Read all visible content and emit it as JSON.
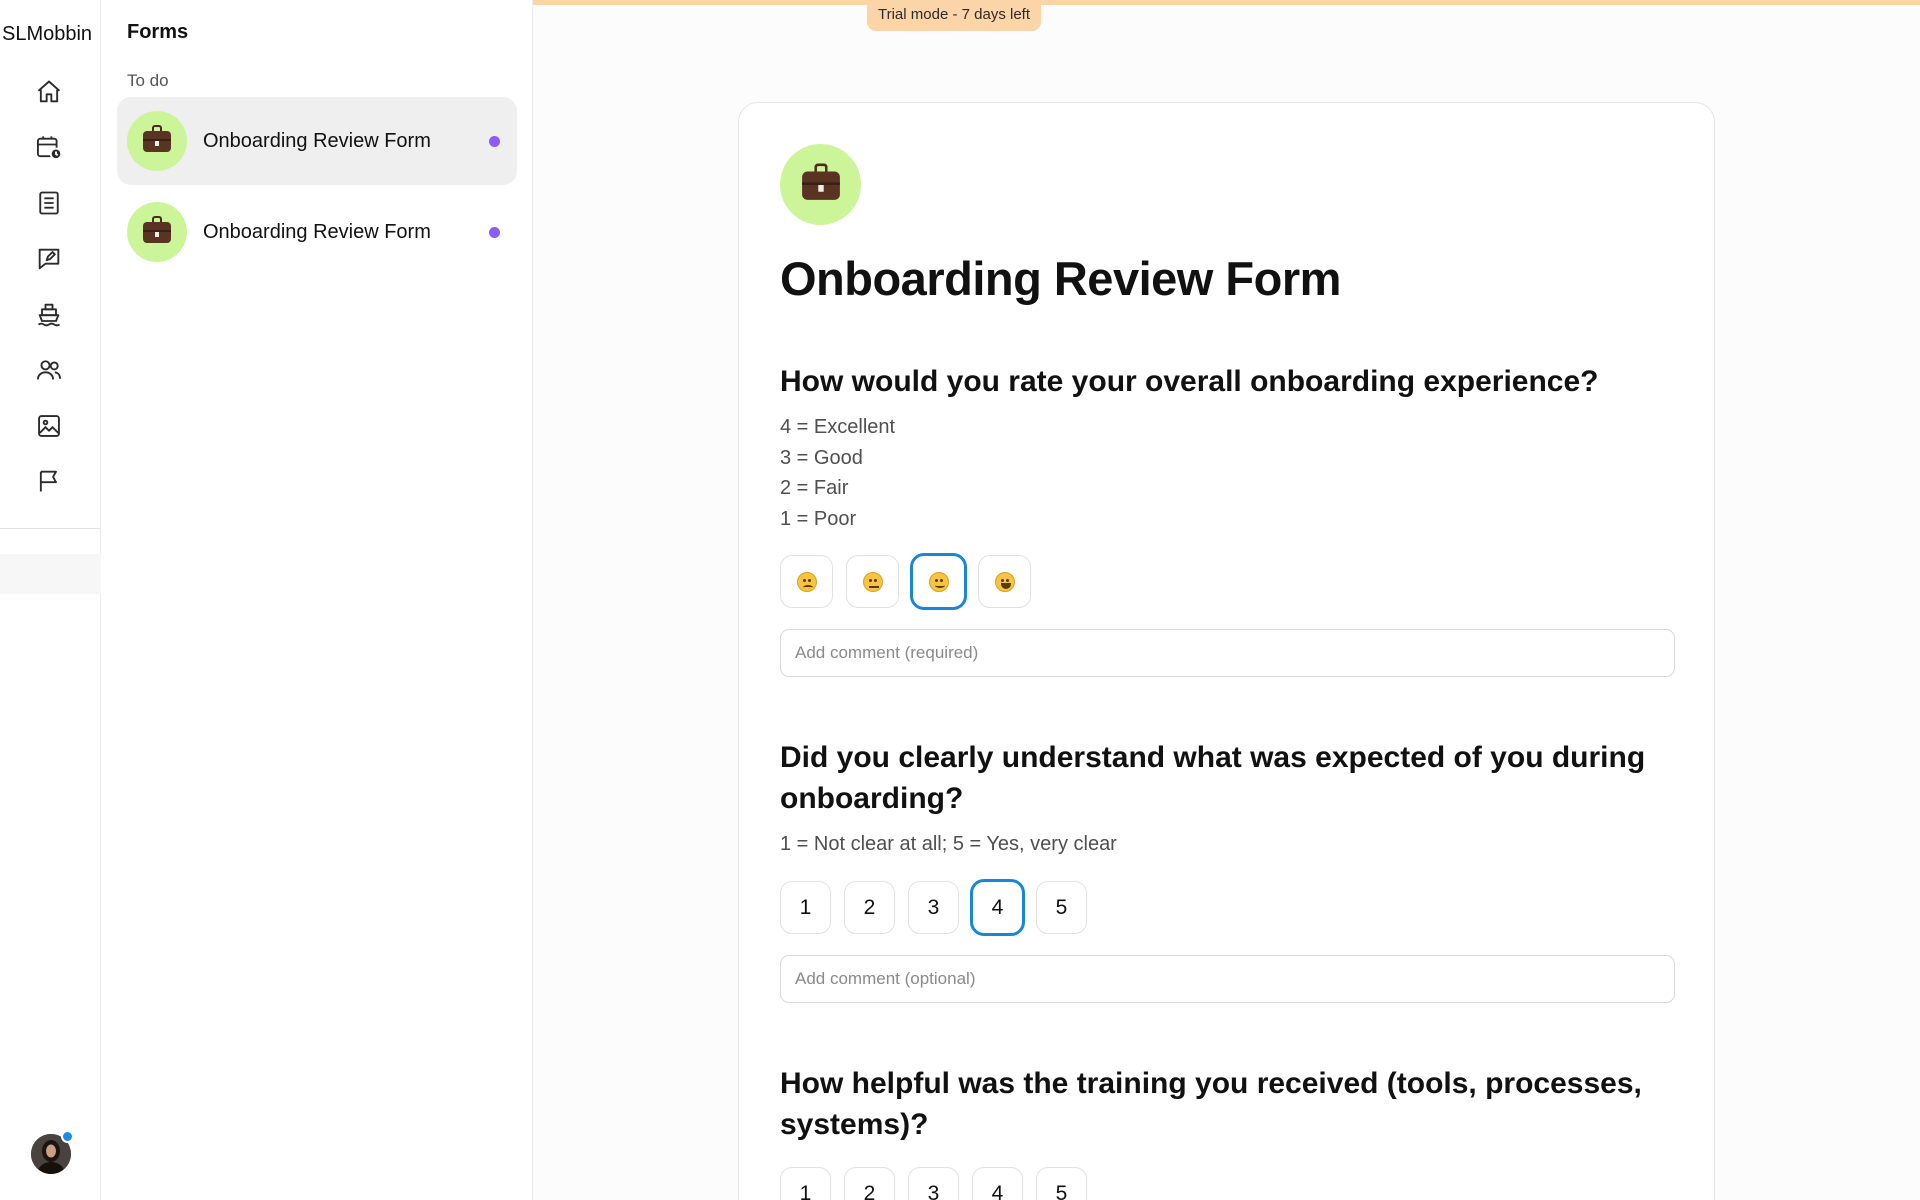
{
  "trial_banner": "Trial mode - 7 days left",
  "workspace": {
    "name": "SLMobbin"
  },
  "rail": {
    "icons": [
      "home-icon",
      "calendar-clock-icon",
      "document-icon",
      "feedback-icon",
      "ship-icon",
      "people-icon",
      "image-icon",
      "flag-icon"
    ]
  },
  "forms_list": {
    "title": "Forms",
    "section": "To do",
    "items": [
      {
        "label": "Onboarding Review Form",
        "selected": true,
        "unread": true
      },
      {
        "label": "Onboarding Review Form",
        "selected": false,
        "unread": true
      }
    ]
  },
  "form": {
    "title": "Onboarding Review Form",
    "questions": [
      {
        "text": "How would you rate your overall onboarding experience?",
        "legend": [
          "4 = Excellent",
          "3 = Good",
          "2 = Fair",
          "1 = Poor"
        ],
        "type": "emoji",
        "options": [
          "frowning-face",
          "unamused-face",
          "grinning-face",
          "star-struck-face"
        ],
        "selected_index": 2,
        "comment_placeholder": "Add comment (required)"
      },
      {
        "text": "Did you clearly understand what was expected of you during onboarding?",
        "legend": [
          "1 = Not clear at all; 5 = Yes, very clear"
        ],
        "type": "scale",
        "options": [
          "1",
          "2",
          "3",
          "4",
          "5"
        ],
        "selected_index": 3,
        "comment_placeholder": "Add comment (optional)"
      },
      {
        "text": "How helpful was the training you received (tools, processes, systems)?",
        "type": "scale",
        "options": [
          "1",
          "2",
          "3",
          "4",
          "5"
        ],
        "selected_index": null
      }
    ]
  },
  "colors": {
    "trial_banner": "#fbd5a8",
    "form_icon_bg": "#ccf59a",
    "unread_dot": "#8b5cf6",
    "selected_border": "#1a86d8",
    "avatar_status": "#1a8cf0"
  }
}
